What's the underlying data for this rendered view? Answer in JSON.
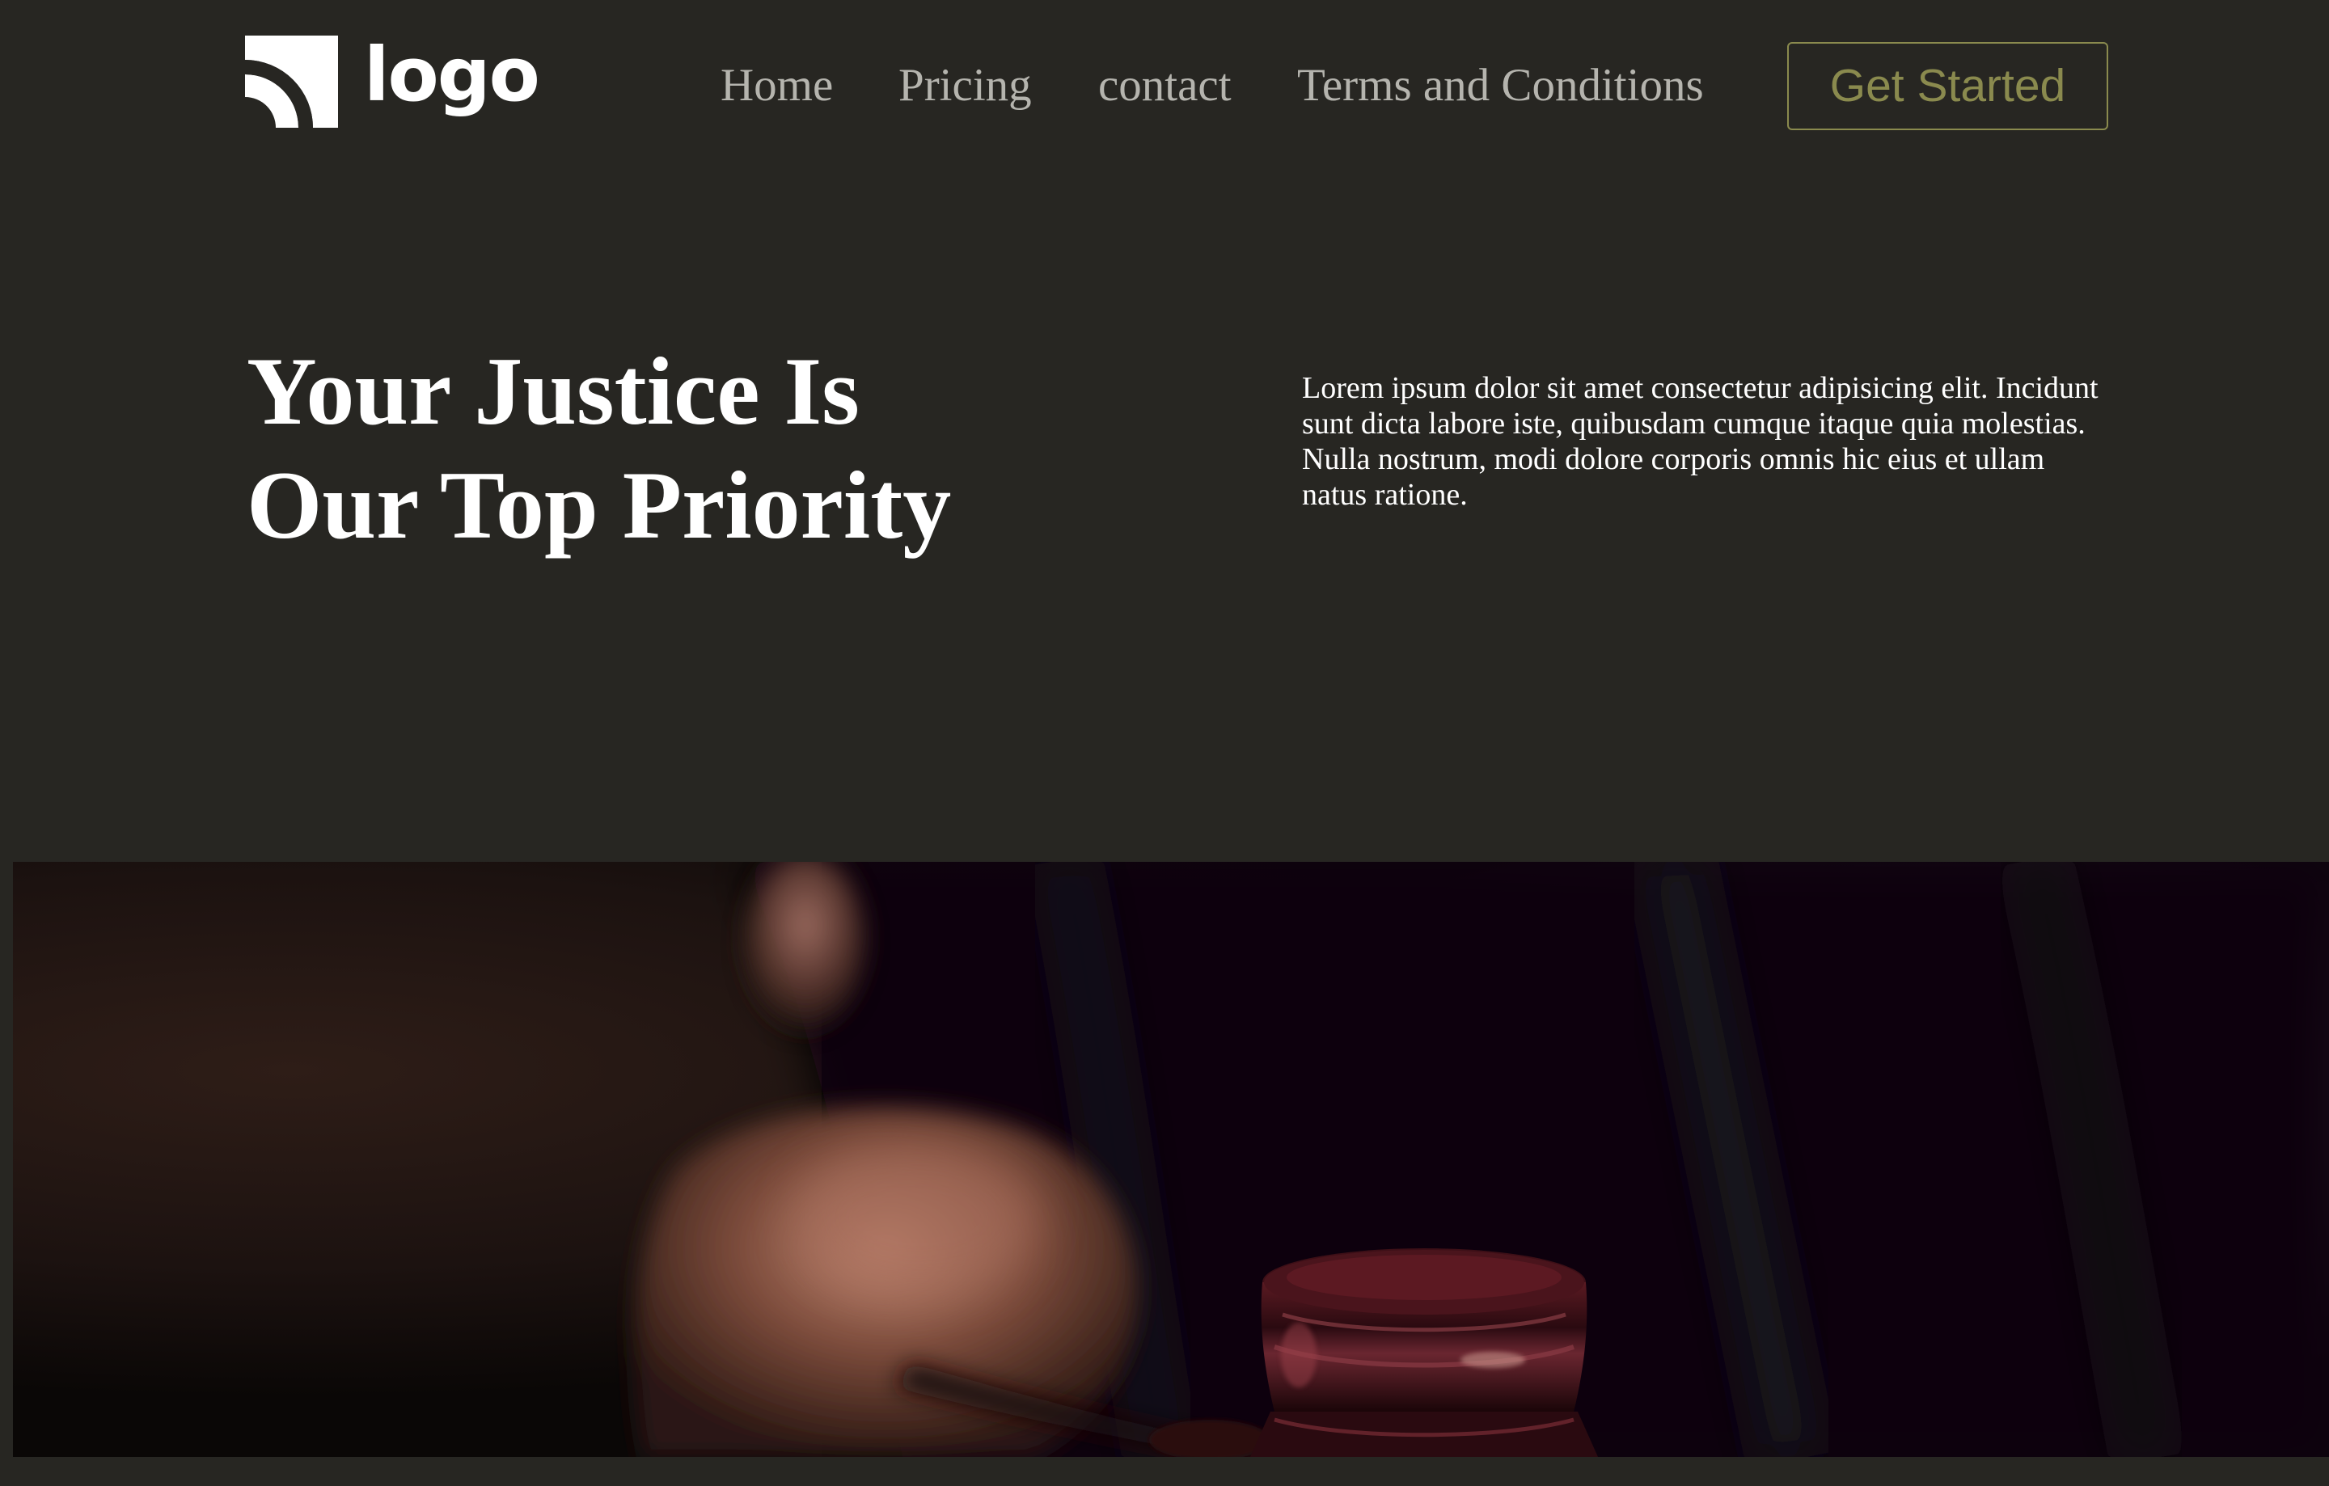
{
  "header": {
    "logo_text": "logo",
    "nav": [
      {
        "label": "Home"
      },
      {
        "label": "Pricing"
      },
      {
        "label": "contact"
      },
      {
        "label": "Terms and Conditions"
      }
    ],
    "cta_label": "Get Started"
  },
  "hero": {
    "title_lines": [
      "Your Justice Is",
      "Our Top Priority"
    ],
    "description_lines": [
      "Lorem ipsum dolor sit amet consectetur adipisicing elit. Incidunt",
      "sunt dicta labore iste, quibusdam cumque itaque quia molestias.",
      "Nulla nostrum, modi dolore corporis omnis hic eius et ullam",
      "natus ratione."
    ]
  },
  "colors": {
    "background": "#272622",
    "accent": "#8a8a4e",
    "nav_text": "#b5b4ae",
    "text": "#ffffff"
  },
  "icons": {
    "logo": "logo-mark-icon"
  }
}
